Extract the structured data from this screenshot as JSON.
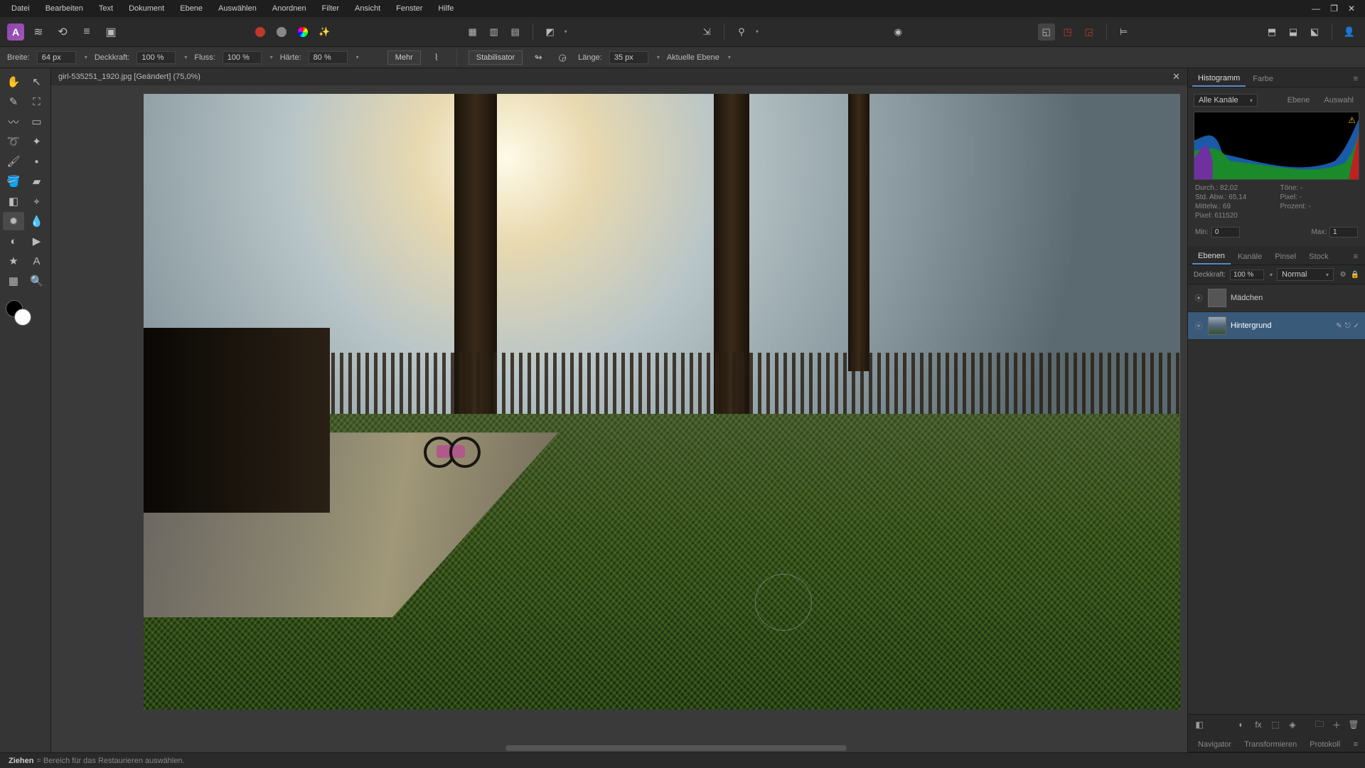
{
  "menubar": {
    "items": [
      "Datei",
      "Bearbeiten",
      "Text",
      "Dokument",
      "Ebene",
      "Auswählen",
      "Anordnen",
      "Filter",
      "Ansicht",
      "Fenster",
      "Hilfe"
    ]
  },
  "window_controls": {
    "min": "—",
    "max": "❐",
    "close": "✕"
  },
  "top_toolbar": {
    "app_letter": "A"
  },
  "options_bar": {
    "breite_label": "Breite:",
    "breite_value": "64 px",
    "deckkraft_label": "Deckkraft:",
    "deckkraft_value": "100 %",
    "fluss_label": "Fluss:",
    "fluss_value": "100 %",
    "haerte_label": "Härte:",
    "haerte_value": "80 %",
    "mehr_label": "Mehr",
    "stabilisator_label": "Stabilisator",
    "laenge_label": "Länge:",
    "laenge_value": "35 px",
    "aktuelle_label": "Aktuelle Ebene"
  },
  "document": {
    "tab_title": "girl-535251_1920.jpg [Geändert] (75,0%)",
    "close": "✕"
  },
  "histogram_panel": {
    "tabs": {
      "histogramm": "Histogramm",
      "farbe": "Farbe",
      "ebene": "Ebene",
      "auswahl": "Auswahl"
    },
    "channel_select": "Alle Kanäle",
    "stats": {
      "durch": "Durch.: 82,02",
      "std": "Std. Abw.: 65,14",
      "mittelw": "Mittelw.: 69",
      "pixel_count": "Pixel: 611520",
      "toene": "Töne: -",
      "pixel": "Pixel: -",
      "prozent": "Prozent: -"
    },
    "min_label": "Min:",
    "min_value": "0",
    "max_label": "Max:",
    "max_value": "1"
  },
  "layers_panel": {
    "tabs": {
      "ebenen": "Ebenen",
      "kanaele": "Kanäle",
      "pinsel": "Pinsel",
      "stock": "Stock"
    },
    "deckkraft_label": "Deckkraft:",
    "deckkraft_value": "100 %",
    "blend_mode": "Normal",
    "layers": [
      {
        "name": "Mädchen",
        "selected": false
      },
      {
        "name": "Hintergrund",
        "selected": true
      }
    ]
  },
  "bottom_panel": {
    "tabs": {
      "navigator": "Navigator",
      "transformieren": "Transformieren",
      "protokoll": "Protokoll"
    }
  },
  "statusbar": {
    "action": "Ziehen",
    "text": "= Bereich für das Restaurieren auswählen."
  }
}
